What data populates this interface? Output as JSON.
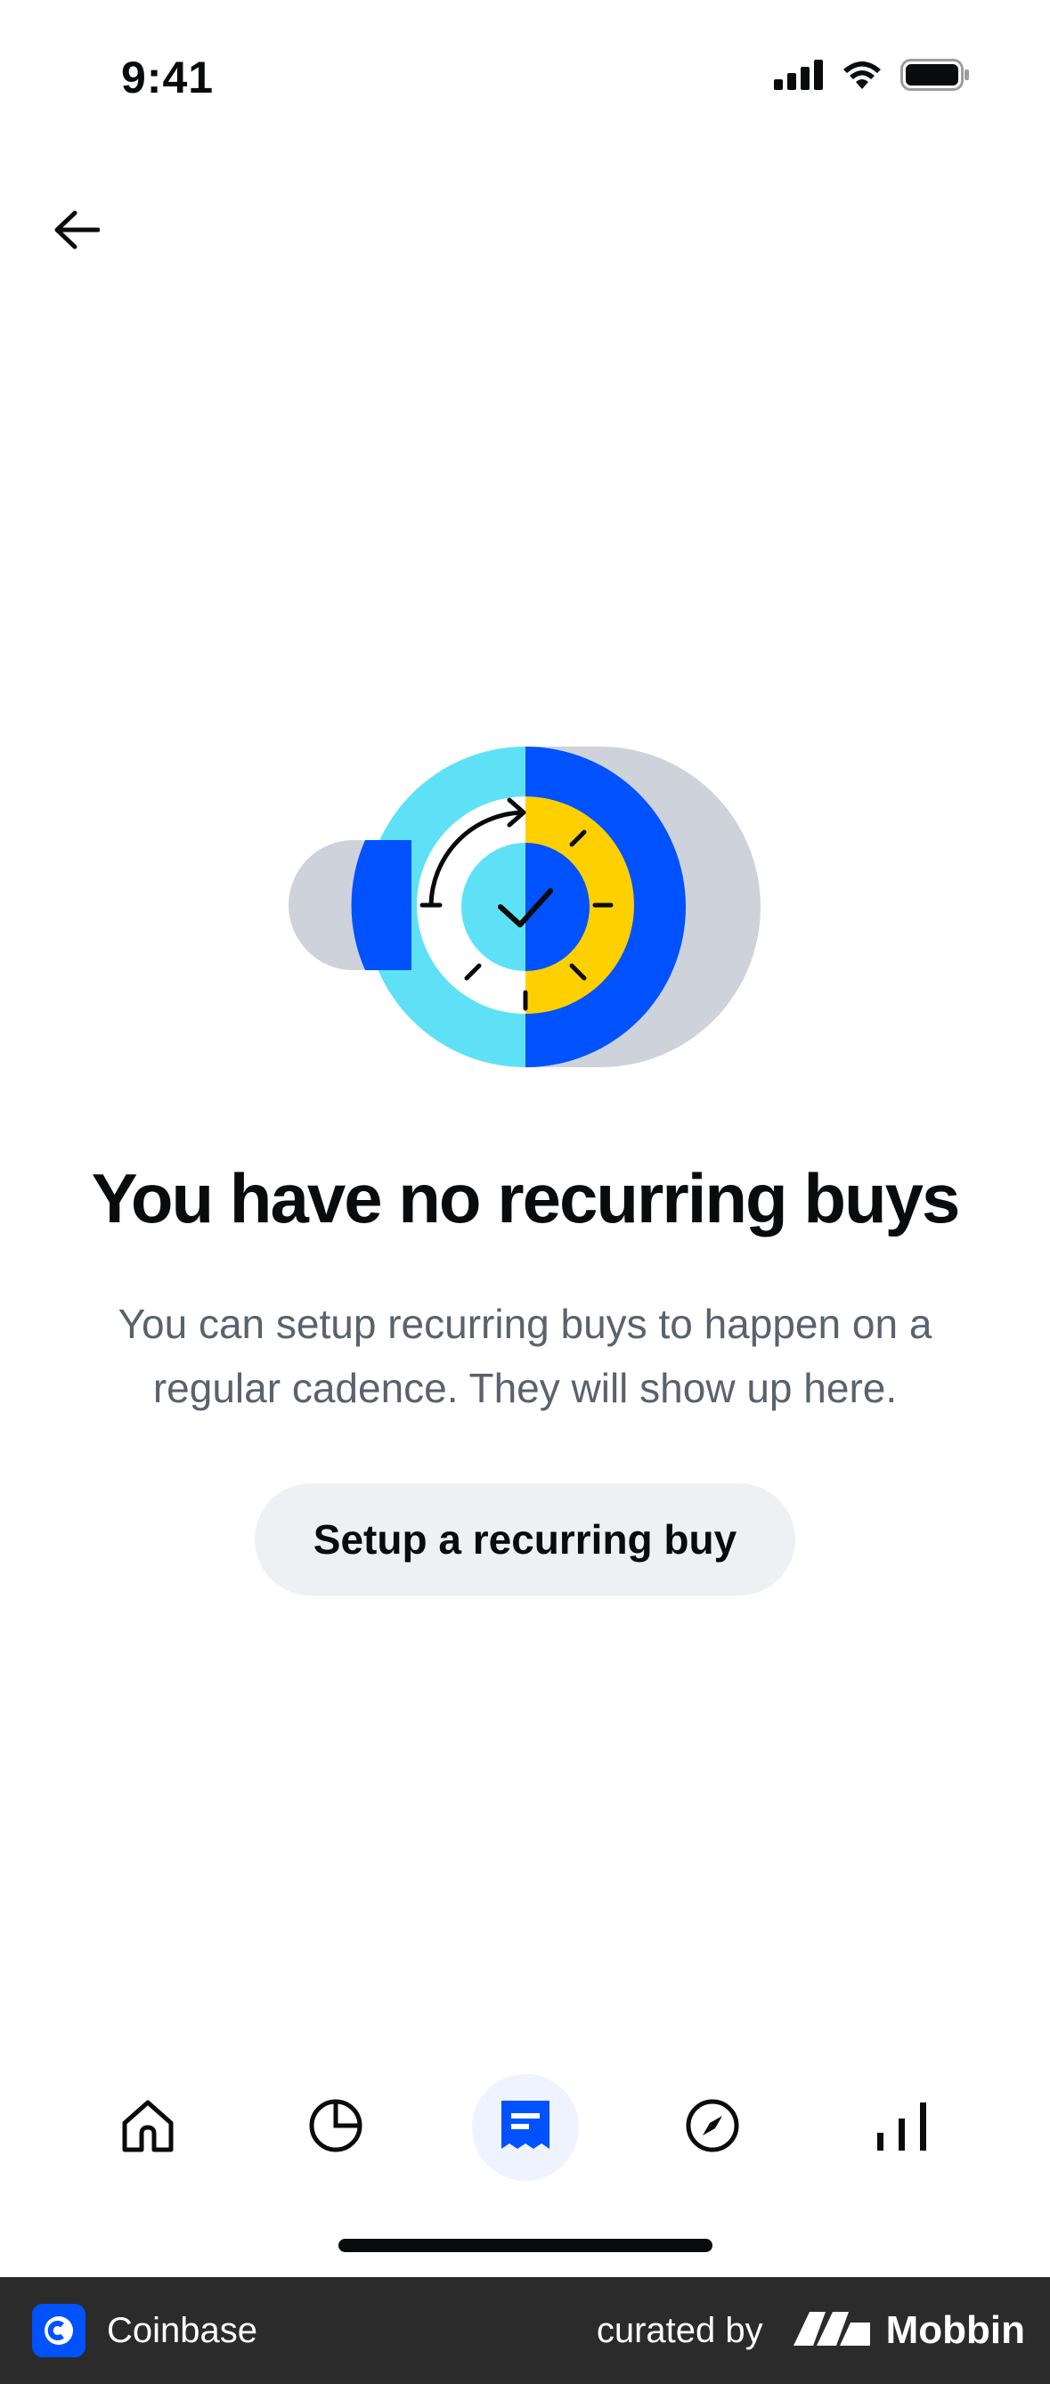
{
  "status_bar": {
    "time": "9:41",
    "icons": [
      "signal-icon",
      "wifi-icon",
      "battery-icon"
    ]
  },
  "header": {
    "back_icon": "arrow-left-icon"
  },
  "empty_state": {
    "illustration": "recurring-clock-illustration",
    "title": "You have no recurring buys",
    "subtitle": "You can setup recurring buys to happen on a regular cadence. They will show up here.",
    "button_label": "Setup a recurring buy"
  },
  "tab_bar": {
    "items": [
      {
        "icon": "home-icon",
        "active": false
      },
      {
        "icon": "portfolio-pie-icon",
        "active": false
      },
      {
        "icon": "transactions-receipt-icon",
        "active": true
      },
      {
        "icon": "explore-compass-icon",
        "active": false
      },
      {
        "icon": "markets-bars-icon",
        "active": false
      }
    ]
  },
  "footer": {
    "app_name": "Coinbase",
    "curated_by": "curated by",
    "brand": "Mobbin"
  },
  "colors": {
    "accent_blue": "#0052ff",
    "light_cyan": "#5ee1f7",
    "yellow": "#ffd000",
    "grey_shape": "#ced2db",
    "text_secondary": "#5b616e",
    "button_bg": "#eef0f3"
  }
}
